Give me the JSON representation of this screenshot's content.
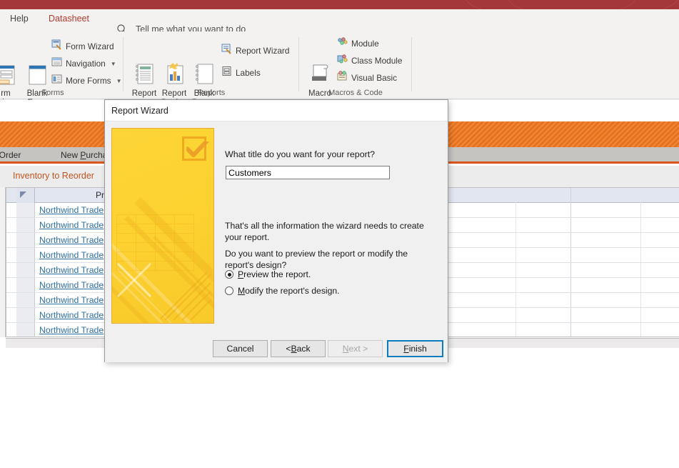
{
  "app": {
    "tabs": [
      {
        "key": "help",
        "label": "Help"
      },
      {
        "key": "datasheet",
        "label": "Datasheet"
      }
    ],
    "tell_me": "Tell me what you want to do",
    "search_icon": "search-icon",
    "accent_red": "#a4373a",
    "accent_orange": "#e8711a"
  },
  "ribbon": {
    "groups": [
      {
        "key": "forms",
        "label": "Forms",
        "big_buttons": [
          {
            "key": "form-design",
            "label": "rm\nsign"
          },
          {
            "key": "blank-form",
            "label": "Blank\nForm"
          }
        ],
        "small_buttons": [
          {
            "key": "form-wizard",
            "label": "Form Wizard",
            "icon": "form-wizard-icon",
            "caret": false
          },
          {
            "key": "navigation",
            "label": "Navigation",
            "icon": "navigation-icon",
            "caret": true
          },
          {
            "key": "more-forms",
            "label": "More Forms",
            "icon": "more-forms-icon",
            "caret": true
          }
        ]
      },
      {
        "key": "reports",
        "label": "Reports",
        "big_buttons": [
          {
            "key": "report",
            "label": "Report"
          },
          {
            "key": "report-design",
            "label": "Report\nDesign"
          },
          {
            "key": "blank-report",
            "label": "Blank\nReport"
          }
        ],
        "small_buttons": [
          {
            "key": "report-wizard",
            "label": "Report Wizard",
            "icon": "report-wizard-icon",
            "caret": false
          },
          {
            "key": "labels",
            "label": "Labels",
            "icon": "labels-icon",
            "caret": false
          }
        ]
      },
      {
        "key": "macros-code",
        "label": "Macros & Code",
        "big_buttons": [
          {
            "key": "macro",
            "label": "Macro"
          }
        ],
        "small_buttons": [
          {
            "key": "module",
            "label": "Module",
            "icon": "module-icon",
            "caret": false
          },
          {
            "key": "class-module",
            "label": "Class Module",
            "icon": "class-module-icon",
            "caret": false
          },
          {
            "key": "visual-basic",
            "label": "Visual Basic",
            "icon": "visual-basic-icon",
            "caret": false
          }
        ]
      }
    ]
  },
  "background": {
    "nav_items": [
      {
        "key": "new-customer-order",
        "pre": "omer Order",
        "ak": "",
        "post": ""
      },
      {
        "key": "new-purchase-order",
        "pre": "New ",
        "ak": "P",
        "post": "urchas"
      }
    ],
    "section_title": "Inventory to Reorder",
    "grid": {
      "header": "Pr",
      "rows": [
        {
          "product": "Northwind Trade"
        },
        {
          "product": "Northwind Trade"
        },
        {
          "product": "Northwind Trade"
        },
        {
          "product": "Northwind Trade"
        },
        {
          "product": "Northwind Trade"
        },
        {
          "product": "Northwind Trade"
        },
        {
          "product": "Northwind Trade"
        },
        {
          "product": "Northwind Trade"
        },
        {
          "product": "Northwind Trade"
        }
      ]
    }
  },
  "dialog": {
    "title": "Report Wizard",
    "question": "What title do you want for your report?",
    "title_input": {
      "value": "Customers",
      "placeholder": ""
    },
    "paragraph_1": "That's all the information the wizard needs to create your report.",
    "paragraph_2": "Do you want to preview the report or modify the report's design?",
    "options": [
      {
        "key": "preview",
        "ak": "P",
        "rest": "review the report.",
        "selected": true
      },
      {
        "key": "modify",
        "ak": "M",
        "rest": "odify the report's design.",
        "selected": false
      }
    ],
    "buttons": {
      "cancel": {
        "label": "Cancel",
        "state": "normal"
      },
      "back": {
        "pre": "< ",
        "ak": "B",
        "post": "ack",
        "state": "normal"
      },
      "next": {
        "ak": "N",
        "post": "ext >",
        "state": "disabled"
      },
      "finish": {
        "ak": "F",
        "post": "inish",
        "state": "focused"
      }
    },
    "focus_color": "#0a7bbd"
  }
}
